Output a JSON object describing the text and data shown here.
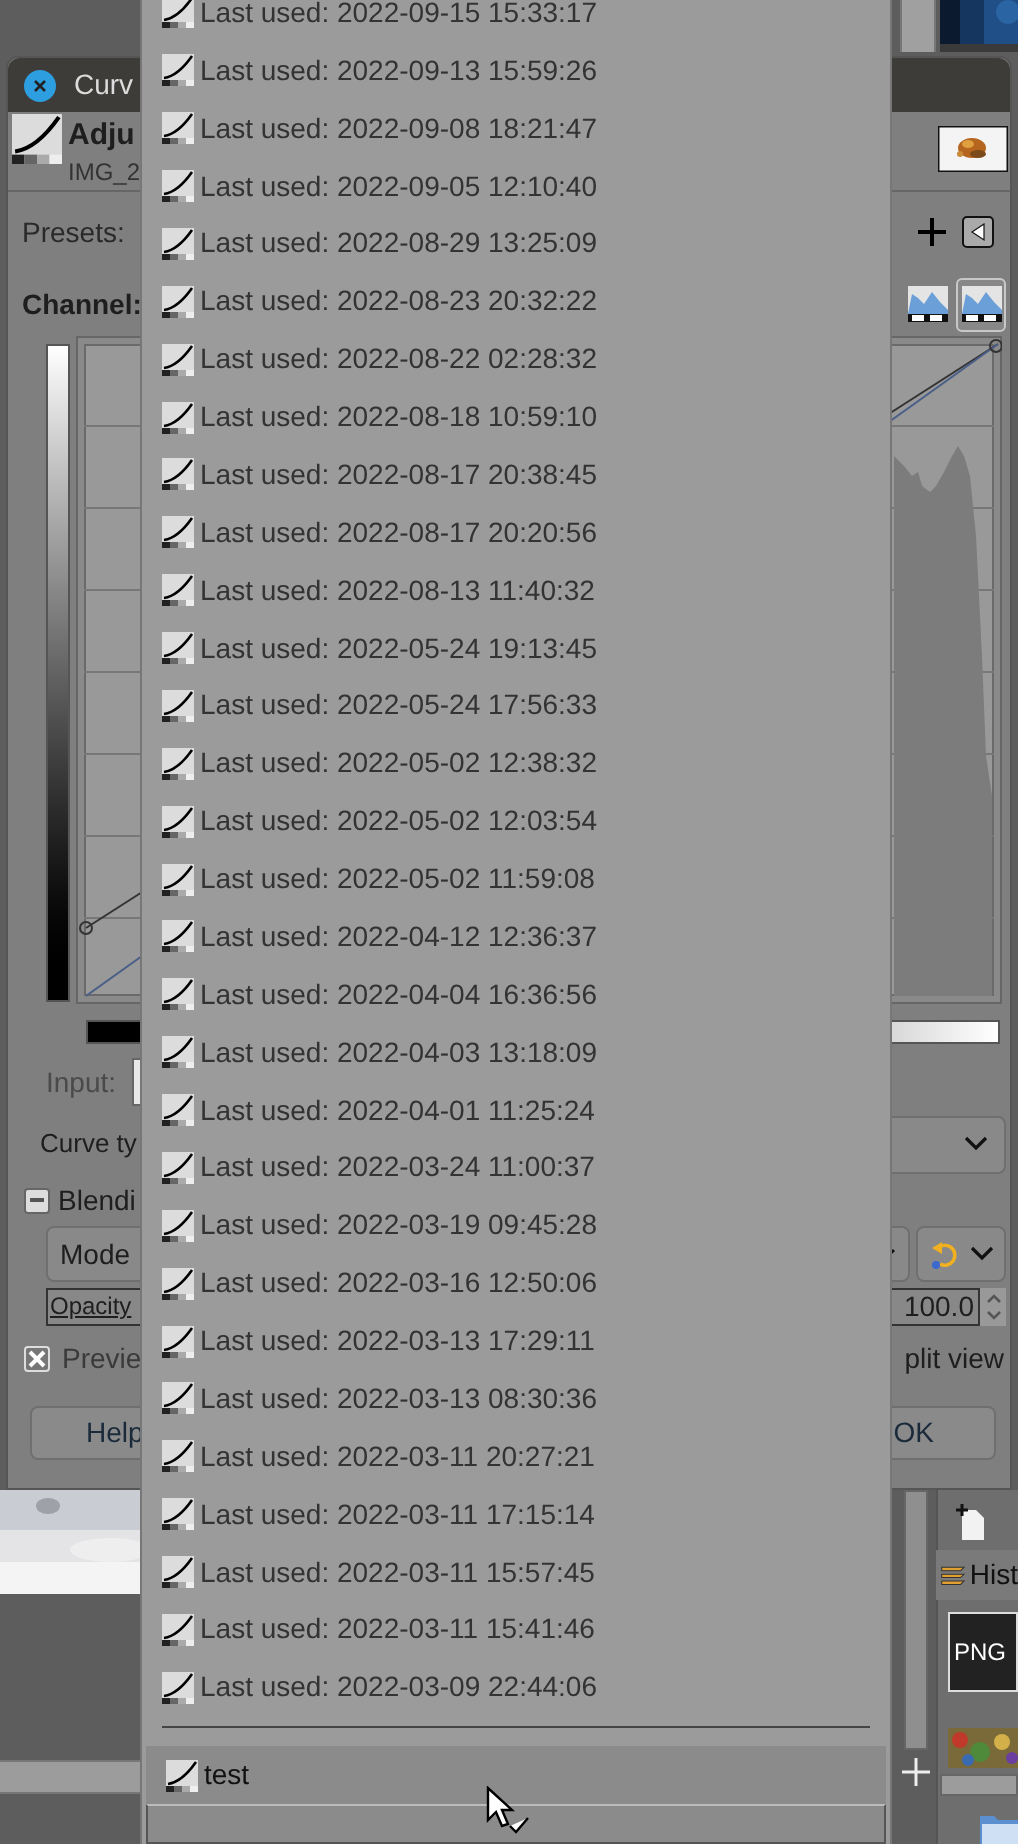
{
  "dialog": {
    "title": "Curv",
    "heading": "Adju",
    "subheading": "IMG_2",
    "presets_label": "Presets:",
    "channel_label": "Channel:",
    "histogram_scale_buttons": [
      {
        "selected": false
      },
      {
        "selected": true
      }
    ],
    "input": {
      "label": "Input:",
      "disabled": true
    },
    "curve_type_label": "Curve ty",
    "blending": {
      "label": "Blendi",
      "expanded": true
    },
    "mode_label": "Mode",
    "opacity": {
      "label": "Opacity",
      "value": "100.0"
    },
    "preview": {
      "label": "Previe",
      "checked": true
    },
    "split_view_label": "plit view",
    "buttons": [
      {
        "label": "Help"
      },
      {
        "label": "OK"
      }
    ]
  },
  "presets_menu": {
    "recent": [
      {
        "label": "Last used: 2022-09-15 15:33:17",
        "selected": false
      },
      {
        "label": "Last used: 2022-09-13 15:59:26",
        "selected": false
      },
      {
        "label": "Last used: 2022-09-08 18:21:47",
        "selected": false
      },
      {
        "label": "Last used: 2022-09-05 12:10:40",
        "selected": false
      },
      {
        "label": "Last used: 2022-08-29 13:25:09",
        "selected": false
      },
      {
        "label": "Last used: 2022-08-23 20:32:22",
        "selected": false
      },
      {
        "label": "Last used: 2022-08-22 02:28:32",
        "selected": false
      },
      {
        "label": "Last used: 2022-08-18 10:59:10",
        "selected": false
      },
      {
        "label": "Last used: 2022-08-17 20:38:45",
        "selected": false
      },
      {
        "label": "Last used: 2022-08-17 20:20:56",
        "selected": false
      },
      {
        "label": "Last used: 2022-08-13 11:40:32",
        "selected": false
      },
      {
        "label": "Last used: 2022-05-24 19:13:45",
        "selected": false
      },
      {
        "label": "Last used: 2022-05-24 17:56:33",
        "selected": false
      },
      {
        "label": "Last used: 2022-05-02 12:38:32",
        "selected": false
      },
      {
        "label": "Last used: 2022-05-02 12:03:54",
        "selected": false
      },
      {
        "label": "Last used: 2022-05-02 11:59:08",
        "selected": false
      },
      {
        "label": "Last used: 2022-04-12 12:36:37",
        "selected": false
      },
      {
        "label": "Last used: 2022-04-04 16:36:56",
        "selected": false
      },
      {
        "label": "Last used: 2022-04-03 13:18:09",
        "selected": false
      },
      {
        "label": "Last used: 2022-04-01 11:25:24",
        "selected": false
      },
      {
        "label": "Last used: 2022-03-24 11:00:37",
        "selected": false
      },
      {
        "label": "Last used: 2022-03-19 09:45:28",
        "selected": false
      },
      {
        "label": "Last used: 2022-03-16 12:50:06",
        "selected": false
      },
      {
        "label": "Last used: 2022-03-13 17:29:11",
        "selected": false
      },
      {
        "label": "Last used: 2022-03-13 08:30:36",
        "selected": false
      },
      {
        "label": "Last used: 2022-03-11 20:27:21",
        "selected": false
      },
      {
        "label": "Last used: 2022-03-11 17:15:14",
        "selected": false
      },
      {
        "label": "Last used: 2022-03-11 15:57:45",
        "selected": false
      },
      {
        "label": "Last used: 2022-03-11 15:41:46",
        "selected": false
      },
      {
        "label": "Last used: 2022-03-09 22:44:06",
        "selected": false
      }
    ],
    "saved": [
      {
        "label": "test",
        "selected": true
      }
    ]
  },
  "main_window": {
    "dock_tab": "Hist",
    "thumbnail_label": "PNG"
  }
}
